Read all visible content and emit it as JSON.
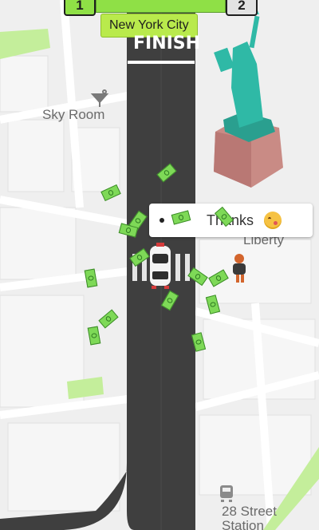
{
  "hud": {
    "current_level": "1",
    "next_level": "2",
    "city": "New York City"
  },
  "map": {
    "finish_text": "FINISH",
    "labels": {
      "sky_room": "Sky Room",
      "liberty": "Liberty",
      "station": "28 Street Station"
    },
    "station_line1": "28 Street",
    "station_line2": "Station"
  },
  "bubble": {
    "text": "Thanks",
    "emoji_name": "kissing-face-emoji"
  },
  "cash_count_visible": 22,
  "colors": {
    "road": "#3f3f3f",
    "accent_green": "#8fe046",
    "city_label_bg": "#b9ea4c",
    "cash_green": "#7ed957",
    "statue_teal": "#2fb9a6",
    "pedestal": "#c98b85"
  }
}
